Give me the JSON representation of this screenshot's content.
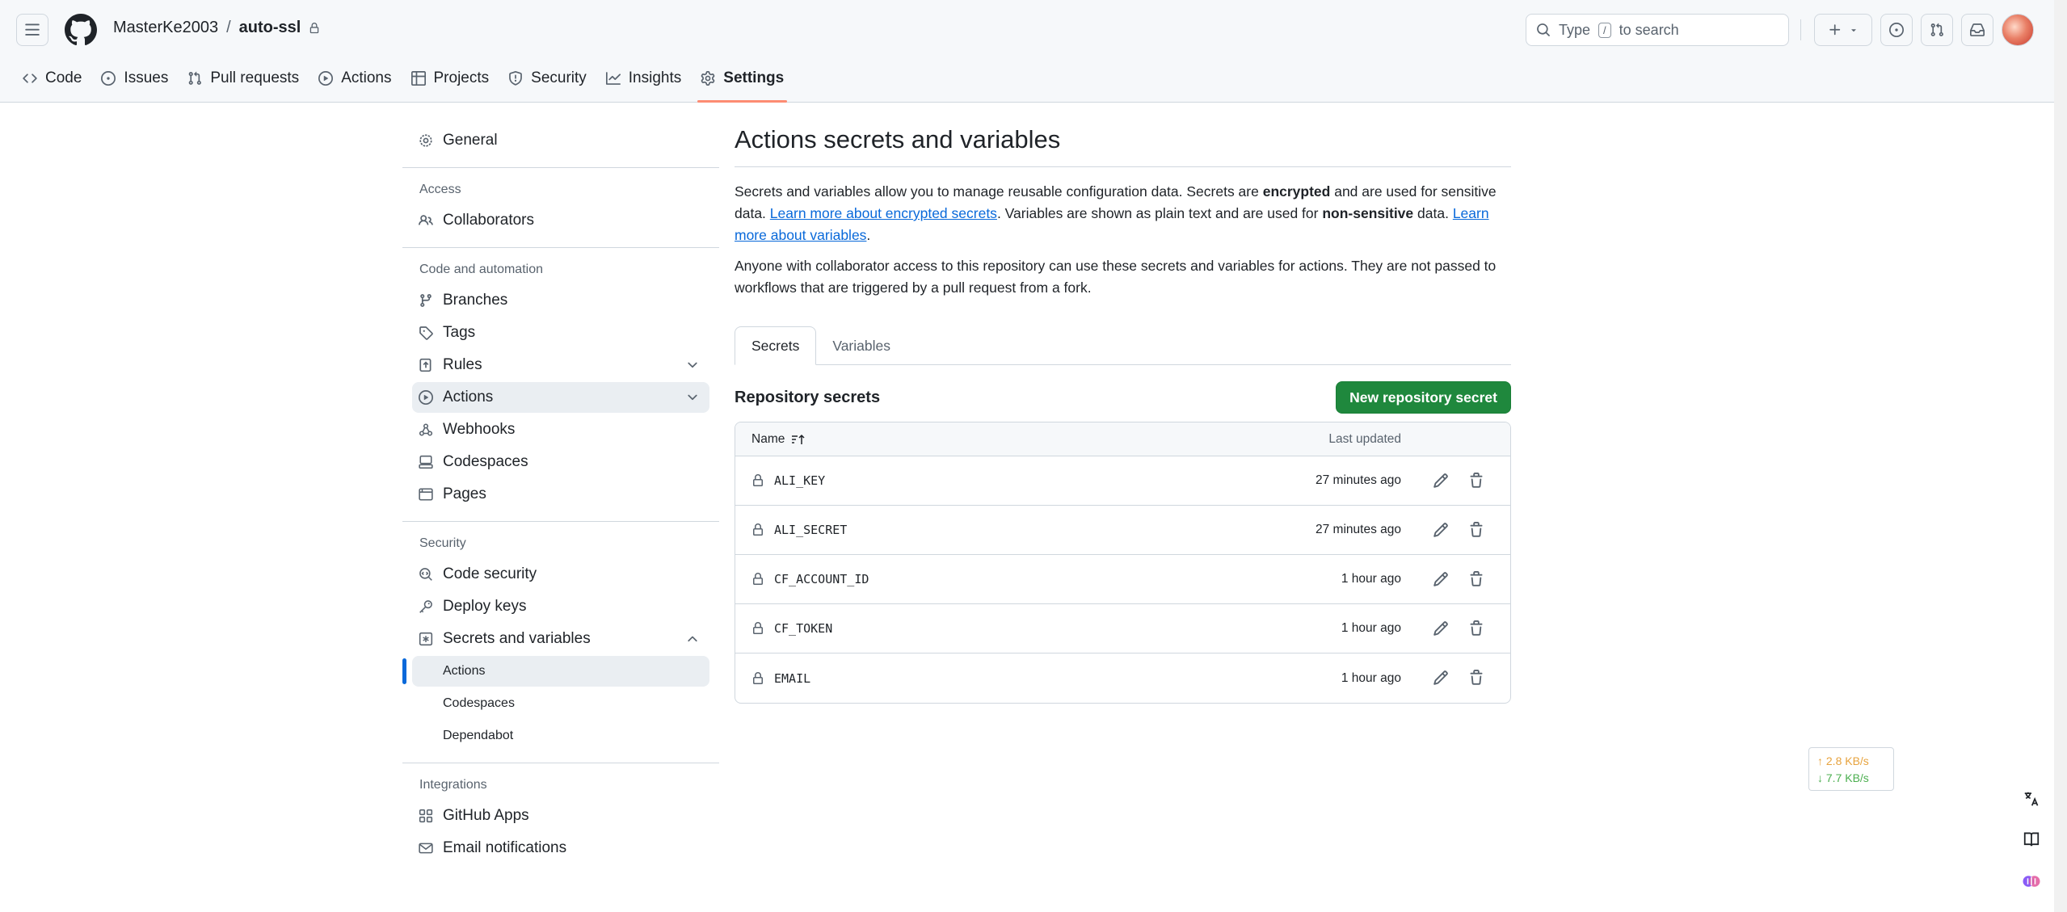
{
  "header": {
    "owner": "MasterKe2003",
    "separator": "/",
    "repo": "auto-ssl",
    "search_prefix": "Type",
    "search_key": "/",
    "search_suffix": "to search"
  },
  "nav": {
    "tabs": [
      {
        "label": "Code",
        "icon": "code-icon"
      },
      {
        "label": "Issues",
        "icon": "issue-icon"
      },
      {
        "label": "Pull requests",
        "icon": "pull-request-icon"
      },
      {
        "label": "Actions",
        "icon": "play-icon"
      },
      {
        "label": "Projects",
        "icon": "table-icon"
      },
      {
        "label": "Security",
        "icon": "shield-icon"
      },
      {
        "label": "Insights",
        "icon": "graph-icon"
      },
      {
        "label": "Settings",
        "icon": "gear-icon",
        "active": true
      }
    ]
  },
  "sidebar": {
    "general": "General",
    "access_head": "Access",
    "collaborators": "Collaborators",
    "code_head": "Code and automation",
    "branches": "Branches",
    "tags": "Tags",
    "rules": "Rules",
    "actions": "Actions",
    "webhooks": "Webhooks",
    "codespaces": "Codespaces",
    "pages": "Pages",
    "security_head": "Security",
    "code_security": "Code security",
    "deploy_keys": "Deploy keys",
    "secrets_vars": "Secrets and variables",
    "sub_actions": "Actions",
    "sub_codespaces": "Codespaces",
    "sub_dependabot": "Dependabot",
    "integrations_head": "Integrations",
    "github_apps": "GitHub Apps",
    "email_notifications": "Email notifications"
  },
  "main": {
    "title": "Actions secrets and variables",
    "desc": {
      "p1": "Secrets and variables allow you to manage reusable configuration data. Secrets are ",
      "b1": "encrypted",
      "p2": " and are used for sensitive data. ",
      "link1": "Learn more about encrypted secrets",
      "p3": ". Variables are shown as plain text and are used for ",
      "b2": "non-sensitive",
      "p4": " data. ",
      "link2": "Learn more about variables",
      "p5": "."
    },
    "desc2": "Anyone with collaborator access to this repository can use these secrets and variables for actions. They are not passed to workflows that are triggered by a pull request from a fork.",
    "tabs": {
      "secrets": "Secrets",
      "variables": "Variables"
    },
    "section_title": "Repository secrets",
    "new_button": "New repository secret",
    "table": {
      "col_name": "Name",
      "col_updated": "Last updated",
      "rows": [
        {
          "name": "ALI_KEY",
          "updated": "27 minutes ago"
        },
        {
          "name": "ALI_SECRET",
          "updated": "27 minutes ago"
        },
        {
          "name": "CF_ACCOUNT_ID",
          "updated": "1 hour ago"
        },
        {
          "name": "CF_TOKEN",
          "updated": "1 hour ago"
        },
        {
          "name": "EMAIL",
          "updated": "1 hour ago"
        }
      ]
    }
  },
  "speed": {
    "up": "↑ 2.8 KB/s",
    "down": "↓ 7.7 KB/s"
  },
  "colors": {
    "accent": "#0969da",
    "primary_button": "#1f883d",
    "tab_underline": "#fd8c73"
  }
}
